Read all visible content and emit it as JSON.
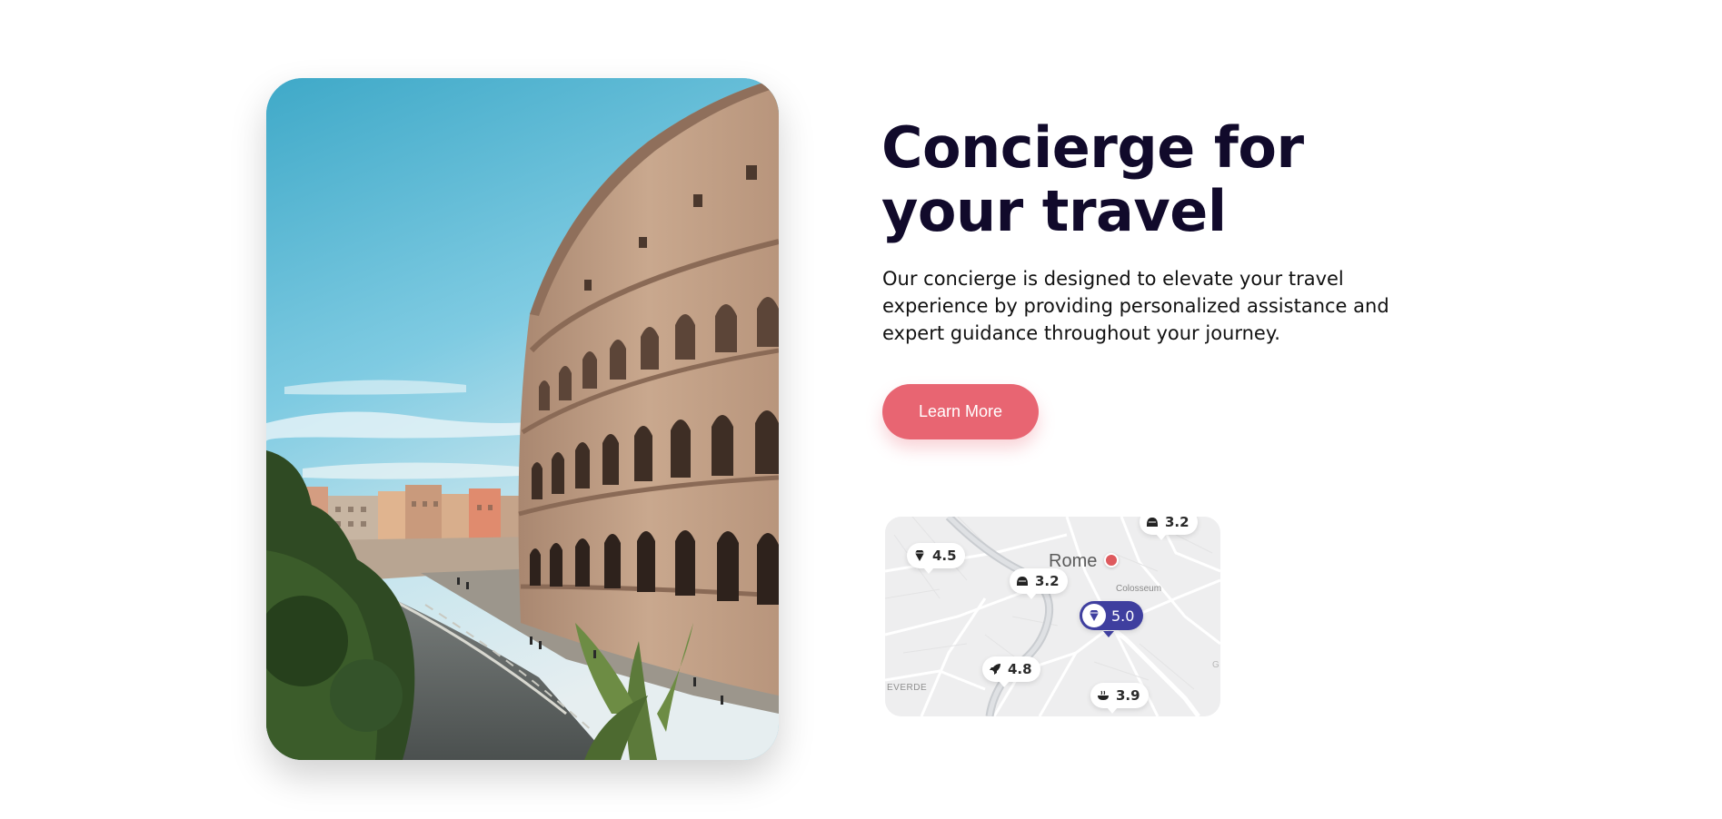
{
  "hero": {
    "title_line1": "Concierge for",
    "title_line2": "your travel",
    "description": "Our concierge is designed to elevate your travel experience by providing personalized assistance and expert guidance throughout your journey.",
    "cta_label": "Learn More"
  },
  "colors": {
    "heading": "#110a2b",
    "cta": "#e86572",
    "featured_pin": "#3f3f9f",
    "city_dot": "#de5a5e"
  },
  "map": {
    "city": "Rome",
    "landmark": "Colosseum",
    "district": "EVERDE",
    "district_partial": "G",
    "pins": [
      {
        "icon": "diamond-icon",
        "rating": "4.5"
      },
      {
        "icon": "helmet-icon",
        "rating": "3.2"
      },
      {
        "icon": "helmet-icon",
        "rating": "3.2"
      },
      {
        "icon": "diamond-icon",
        "rating": "5.0",
        "featured": true
      },
      {
        "icon": "rocket-icon",
        "rating": "4.8"
      },
      {
        "icon": "bowl-icon",
        "rating": "3.9"
      }
    ]
  }
}
